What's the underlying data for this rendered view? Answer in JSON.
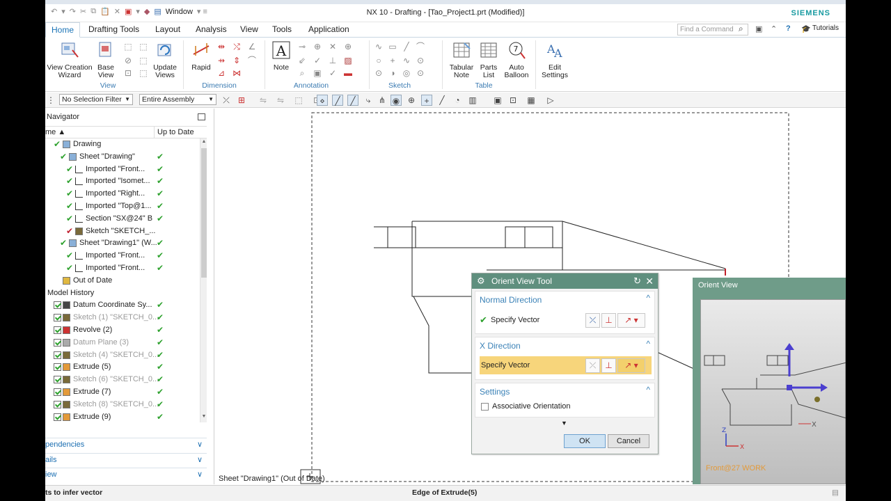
{
  "window": {
    "title": "NX 10 - Drafting - [Tao_Project1.prt (Modified)]",
    "brand": "SIEMENS",
    "window_menu": "Window"
  },
  "tabs": [
    "Home",
    "Drafting Tools",
    "Layout",
    "Analysis",
    "View",
    "Tools",
    "Application"
  ],
  "active_tab": "Home",
  "search": {
    "placeholder": "Find a Command"
  },
  "tutorials": "Tutorials",
  "ribbon": {
    "view_creation_wizard": [
      "View Creation",
      "Wizard"
    ],
    "base_view": [
      "Base",
      "View"
    ],
    "update_views": [
      "Update",
      "Views"
    ],
    "rapid": "Rapid",
    "note": "Note",
    "tabular_note": [
      "Tabular",
      "Note"
    ],
    "parts_list": [
      "Parts",
      "List"
    ],
    "auto_balloon": [
      "Auto",
      "Balloon"
    ],
    "edit_settings": [
      "Edit",
      "Settings"
    ],
    "groups": {
      "view": "View",
      "dimension": "Dimension",
      "annotation": "Annotation",
      "sketch": "Sketch",
      "table": "Table"
    }
  },
  "selection": {
    "filter": "No Selection Filter",
    "scope": "Entire Assembly"
  },
  "navigator": {
    "title": "Navigator",
    "col_name": "me",
    "col_uptodate": "Up to Date",
    "rows": [
      {
        "label": "Drawing",
        "indent": 1,
        "uptodate": false
      },
      {
        "label": "Sheet \"Drawing\"",
        "indent": 2,
        "uptodate": true
      },
      {
        "label": "Imported \"Front...",
        "indent": 3,
        "uptodate": true
      },
      {
        "label": "Imported \"Isomet...",
        "indent": 3,
        "uptodate": true
      },
      {
        "label": "Imported \"Right...",
        "indent": 3,
        "uptodate": true
      },
      {
        "label": "Imported \"Top@1...",
        "indent": 3,
        "uptodate": true
      },
      {
        "label": "Section \"SX@24\" B",
        "indent": 3,
        "uptodate": true
      },
      {
        "label": "Sketch \"SKETCH_...",
        "indent": 3,
        "uptodate": false
      },
      {
        "label": "Sheet \"Drawing1\" (W...",
        "indent": 2,
        "uptodate": true
      },
      {
        "label": "Imported \"Front...",
        "indent": 3,
        "uptodate": true
      },
      {
        "label": "Imported \"Front...",
        "indent": 3,
        "uptodate": true
      },
      {
        "label": "Out of Date",
        "indent": 1,
        "uptodate": false
      },
      {
        "label": "Model History",
        "indent": 0,
        "uptodate": false
      },
      {
        "label": "Datum Coordinate Sy...",
        "indent": 1,
        "uptodate": true
      },
      {
        "label": "Sketch (1) \"SKETCH_0...",
        "indent": 1,
        "uptodate": true,
        "gray": true
      },
      {
        "label": "Revolve (2)",
        "indent": 1,
        "uptodate": true
      },
      {
        "label": "Datum Plane (3)",
        "indent": 1,
        "uptodate": true,
        "gray": true
      },
      {
        "label": "Sketch (4) \"SKETCH_0...",
        "indent": 1,
        "uptodate": true,
        "gray": true
      },
      {
        "label": "Extrude (5)",
        "indent": 1,
        "uptodate": true
      },
      {
        "label": "Sketch (6) \"SKETCH_0...",
        "indent": 1,
        "uptodate": true,
        "gray": true
      },
      {
        "label": "Extrude (7)",
        "indent": 1,
        "uptodate": true
      },
      {
        "label": "Sketch (8) \"SKETCH_0...",
        "indent": 1,
        "uptodate": true,
        "gray": true
      },
      {
        "label": "Extrude (9)",
        "indent": 1,
        "uptodate": true
      }
    ],
    "sections": [
      "pendencies",
      "ails",
      "iew"
    ]
  },
  "canvas": {
    "sheet_label": "Sheet \"Drawing1\" (Out of Date)"
  },
  "dialog": {
    "title": "Orient View Tool",
    "normal_direction": "Normal Direction",
    "specify_vector_1": "Specify Vector",
    "x_direction": "X Direction",
    "specify_vector_2": "Specify Vector",
    "settings": "Settings",
    "associative": "Associative Orientation",
    "ok": "OK",
    "cancel": "Cancel"
  },
  "orient_view": {
    "title": "Orient View",
    "work_label": "Front@27 WORK"
  },
  "status": {
    "left": "ts to infer vector",
    "center": "Edge of Extrude(5)"
  },
  "colors": {
    "dialog_title": "#5f8f7e",
    "accent_blue": "#3b82b7",
    "highlight": "#f7d57b",
    "check_green": "#2ea12e",
    "brand": "#179aa0"
  }
}
